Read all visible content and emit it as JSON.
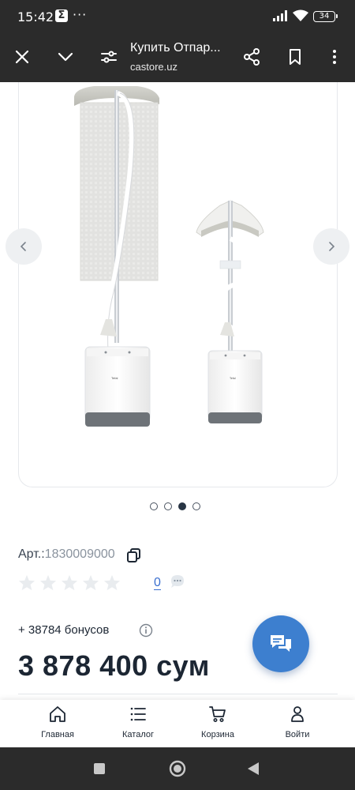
{
  "status_bar": {
    "time": "15:42",
    "notification_icon": "sigma-icon",
    "more": "···",
    "battery": "34"
  },
  "browser": {
    "title": "Купить Отпар...",
    "url": "castore.uz",
    "icons": [
      "close-icon",
      "chevron-down-icon",
      "site-settings-icon",
      "share-icon",
      "bookmark-icon",
      "more-vert-icon"
    ]
  },
  "gallery": {
    "slide_count": 4,
    "active_slide": 3,
    "image": "garment-steamer-product-photo",
    "brand_text": "Tefal"
  },
  "product": {
    "article_label": "Арт.:",
    "article_value": "1830009000",
    "rating_stars": 0,
    "rating_max": 5,
    "reviews_count": "0",
    "bonus_text": "+ 38784 бонусов",
    "price": "3 878 400 сум"
  },
  "bottom_nav": {
    "items": [
      {
        "label": "Главная",
        "icon": "home-icon"
      },
      {
        "label": "Каталог",
        "icon": "catalog-icon"
      },
      {
        "label": "Корзина",
        "icon": "cart-icon"
      },
      {
        "label": "Войти",
        "icon": "user-icon"
      }
    ]
  },
  "colors": {
    "accent": "#3d7fcf",
    "dark_bar": "#2b2b2b",
    "text": "#1c2633",
    "star_empty": "#e9ecef"
  }
}
